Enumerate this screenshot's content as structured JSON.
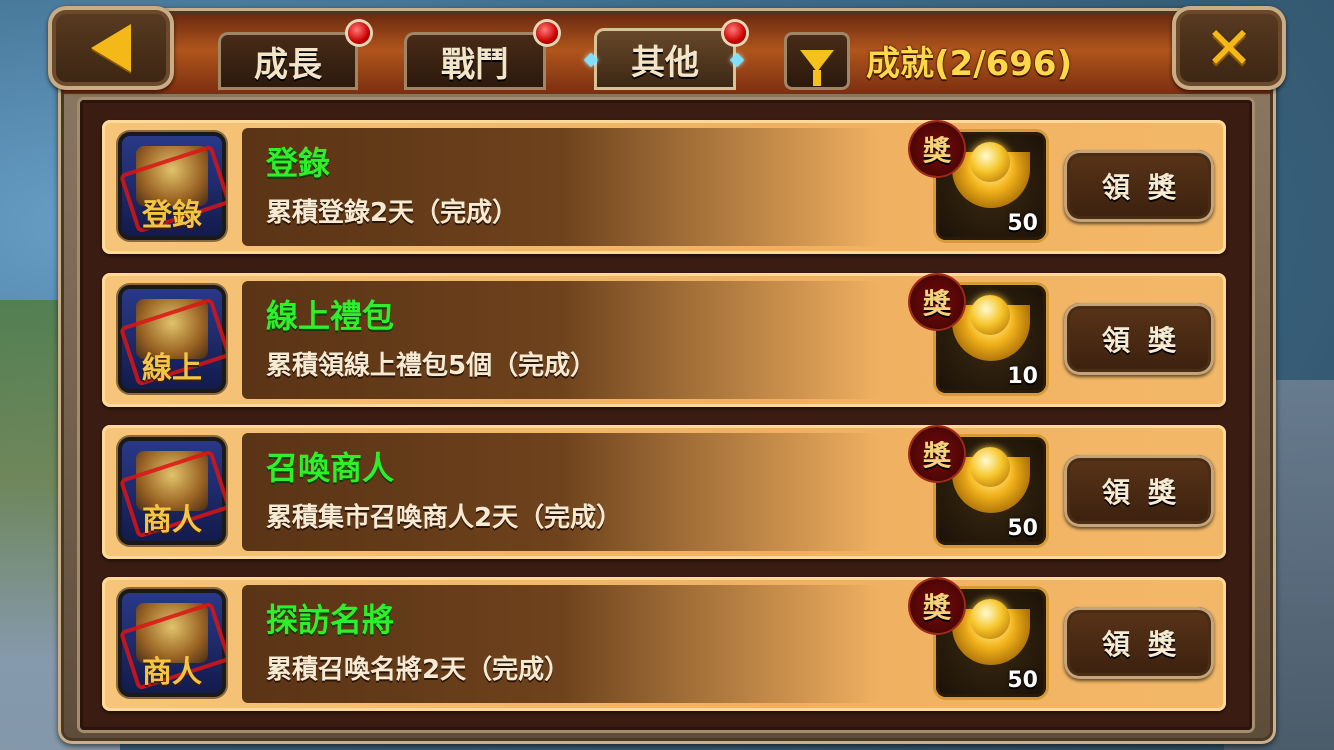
{
  "header": {
    "tabs": [
      {
        "label": "成長",
        "active": false,
        "badge": true
      },
      {
        "label": "戰鬥",
        "active": false,
        "badge": true
      },
      {
        "label": "其他",
        "active": true,
        "badge": true
      }
    ],
    "achievement_title": "成就(2/696)",
    "back_icon": "back-arrow-icon",
    "close_icon": "close-icon",
    "filter_icon": "filter-funnel-icon"
  },
  "achievements": [
    {
      "title": "登錄",
      "description": "累積登錄2天（完成）",
      "icon_label": "登錄",
      "reward_tag": "獎",
      "reward_qty": "50",
      "button": "領獎"
    },
    {
      "title": "線上禮包",
      "description": "累積領線上禮包5個（完成）",
      "icon_label": "線上",
      "reward_tag": "獎",
      "reward_qty": "10",
      "button": "領獎"
    },
    {
      "title": "召喚商人",
      "description": "累積集市召喚商人2天（完成）",
      "icon_label": "商人",
      "reward_tag": "獎",
      "reward_qty": "50",
      "button": "領獎"
    },
    {
      "title": "探訪名將",
      "description": "累積召喚名將2天（完成）",
      "icon_label": "商人",
      "reward_tag": "獎",
      "reward_qty": "50",
      "button": "領獎"
    }
  ],
  "colors": {
    "title_green": "#2ef02a",
    "gold": "#f4b818",
    "row_bg": "#f0b060"
  }
}
